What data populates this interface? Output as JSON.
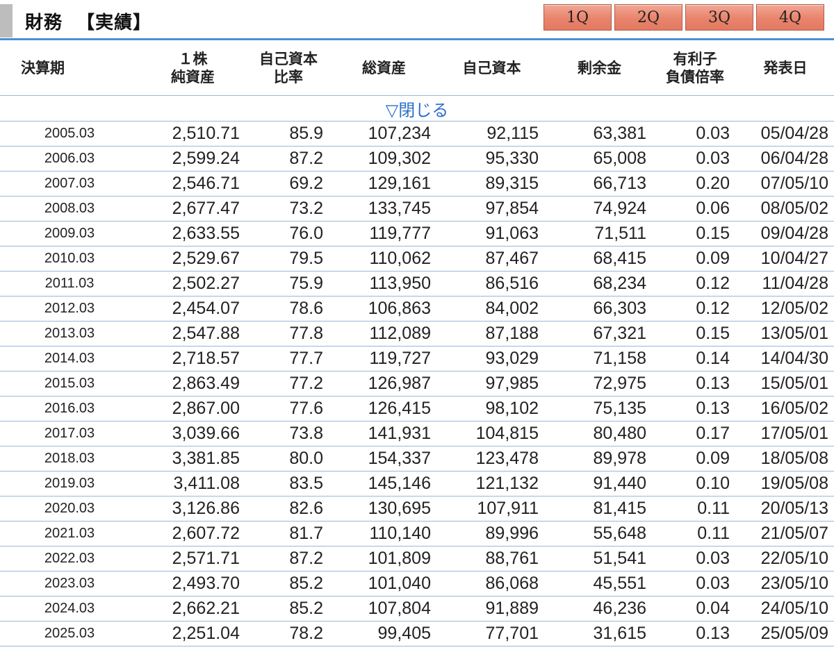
{
  "header": {
    "title": "財務  【実績】",
    "tabs": [
      "1Q",
      "2Q",
      "3Q",
      "4Q"
    ]
  },
  "table": {
    "columns": [
      {
        "line1": "決算期",
        "line2": ""
      },
      {
        "line1": "１株",
        "line2": "純資産"
      },
      {
        "line1": "自己資本",
        "line2": "比率"
      },
      {
        "line1": "総資産",
        "line2": ""
      },
      {
        "line1": "自己資本",
        "line2": ""
      },
      {
        "line1": "剰余金",
        "line2": ""
      },
      {
        "line1": "有利子",
        "line2": "負債倍率"
      },
      {
        "line1": "発表日",
        "line2": ""
      }
    ],
    "toggle_label": "▽閉じる",
    "rows": [
      [
        "2005.03",
        "2,510.71",
        "85.9",
        "107,234",
        "92,115",
        "63,381",
        "0.03",
        "05/04/28"
      ],
      [
        "2006.03",
        "2,599.24",
        "87.2",
        "109,302",
        "95,330",
        "65,008",
        "0.03",
        "06/04/28"
      ],
      [
        "2007.03",
        "2,546.71",
        "69.2",
        "129,161",
        "89,315",
        "66,713",
        "0.20",
        "07/05/10"
      ],
      [
        "2008.03",
        "2,677.47",
        "73.2",
        "133,745",
        "97,854",
        "74,924",
        "0.06",
        "08/05/02"
      ],
      [
        "2009.03",
        "2,633.55",
        "76.0",
        "119,777",
        "91,063",
        "71,511",
        "0.15",
        "09/04/28"
      ],
      [
        "2010.03",
        "2,529.67",
        "79.5",
        "110,062",
        "87,467",
        "68,415",
        "0.09",
        "10/04/27"
      ],
      [
        "2011.03",
        "2,502.27",
        "75.9",
        "113,950",
        "86,516",
        "68,234",
        "0.12",
        "11/04/28"
      ],
      [
        "2012.03",
        "2,454.07",
        "78.6",
        "106,863",
        "84,002",
        "66,303",
        "0.12",
        "12/05/02"
      ],
      [
        "2013.03",
        "2,547.88",
        "77.8",
        "112,089",
        "87,188",
        "67,321",
        "0.15",
        "13/05/01"
      ],
      [
        "2014.03",
        "2,718.57",
        "77.7",
        "119,727",
        "93,029",
        "71,158",
        "0.14",
        "14/04/30"
      ],
      [
        "2015.03",
        "2,863.49",
        "77.2",
        "126,987",
        "97,985",
        "72,975",
        "0.13",
        "15/05/01"
      ],
      [
        "2016.03",
        "2,867.00",
        "77.6",
        "126,415",
        "98,102",
        "75,135",
        "0.13",
        "16/05/02"
      ],
      [
        "2017.03",
        "3,039.66",
        "73.8",
        "141,931",
        "104,815",
        "80,480",
        "0.17",
        "17/05/01"
      ],
      [
        "2018.03",
        "3,381.85",
        "80.0",
        "154,337",
        "123,478",
        "89,978",
        "0.09",
        "18/05/08"
      ],
      [
        "2019.03",
        "3,411.08",
        "83.5",
        "145,146",
        "121,132",
        "91,440",
        "0.10",
        "19/05/08"
      ],
      [
        "2020.03",
        "3,126.86",
        "82.6",
        "130,695",
        "107,911",
        "81,415",
        "0.11",
        "20/05/13"
      ],
      [
        "2021.03",
        "2,607.72",
        "81.7",
        "110,140",
        "89,996",
        "55,648",
        "0.11",
        "21/05/07"
      ],
      [
        "2022.03",
        "2,571.71",
        "87.2",
        "101,809",
        "88,761",
        "51,541",
        "0.03",
        "22/05/10"
      ],
      [
        "2023.03",
        "2,493.70",
        "85.2",
        "101,040",
        "86,068",
        "45,551",
        "0.03",
        "23/05/10"
      ],
      [
        "2024.03",
        "2,662.21",
        "85.2",
        "107,804",
        "91,889",
        "46,236",
        "0.04",
        "24/05/10"
      ],
      [
        "2025.03",
        "2,251.04",
        "78.2",
        "99,405",
        "77,701",
        "31,615",
        "0.13",
        "25/05/09"
      ]
    ]
  }
}
